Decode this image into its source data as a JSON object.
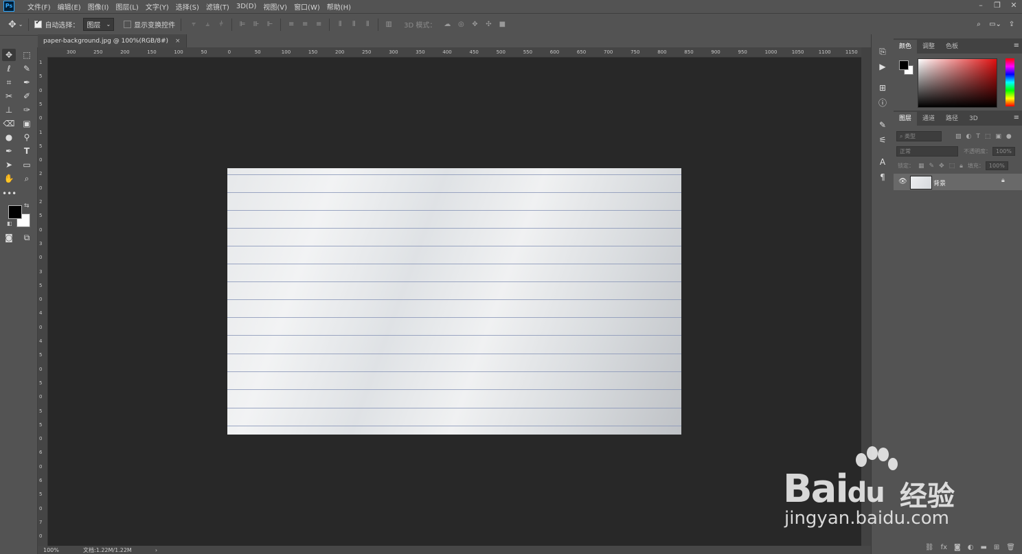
{
  "menubar": {
    "logo": "Ps",
    "items": [
      "文件(F)",
      "编辑(E)",
      "图像(I)",
      "图层(L)",
      "文字(Y)",
      "选择(S)",
      "滤镜(T)",
      "3D(D)",
      "视图(V)",
      "窗口(W)",
      "帮助(H)"
    ]
  },
  "window_controls": {
    "minimize": "–",
    "restore": "❐",
    "close": "✕"
  },
  "options": {
    "auto_select_label": "自动选择：",
    "auto_select_value": "图层",
    "show_transform_label": "显示变换控件",
    "mode_3d_label": "3D 模式："
  },
  "document": {
    "tab_title": "paper-background.jpg @ 100%(RGB/8#)",
    "close": "×"
  },
  "ruler": {
    "h_ticks": [
      "300",
      "250",
      "200",
      "150",
      "100",
      "50",
      "0",
      "50",
      "100",
      "150",
      "200",
      "250",
      "300",
      "350",
      "400",
      "450",
      "500",
      "550",
      "600",
      "650",
      "700",
      "750",
      "800",
      "850",
      "900",
      "950",
      "1000",
      "1050",
      "1100",
      "1150"
    ],
    "v_ticks": [
      "1",
      "5",
      "0",
      "5",
      "0",
      "1",
      "5",
      "0",
      "2",
      "0",
      "2",
      "5",
      "0",
      "3",
      "0",
      "3",
      "5",
      "0",
      "4",
      "0",
      "4",
      "5",
      "0",
      "5",
      "0",
      "5",
      "5",
      "0",
      "6",
      "0",
      "6",
      "5",
      "0",
      "7",
      "0"
    ]
  },
  "status": {
    "zoom": "100%",
    "doc": "文档:1.22M/1.22M",
    "arrow": "›"
  },
  "color_panel": {
    "tabs": [
      "颜色",
      "调整",
      "色板"
    ],
    "foreground": "#000000",
    "background": "#ffffff"
  },
  "layers_panel": {
    "tabs": [
      "图层",
      "通道",
      "路径",
      "3D"
    ],
    "filter_label": "类型",
    "blend_mode": "正常",
    "opacity_label": "不透明度：",
    "opacity_value": "100%",
    "lock_label": "锁定：",
    "fill_label": "填充：",
    "fill_value": "100%",
    "layers": [
      {
        "name": "背景",
        "visible": true,
        "locked": true
      }
    ]
  },
  "watermark": {
    "brand": "Bai",
    "brand2": "du",
    "cn": "经验",
    "url": "jingyan.baidu.com"
  },
  "colors": {
    "canvas": "#282828",
    "ui": "#535353",
    "paper_line": "#8b98b8"
  }
}
